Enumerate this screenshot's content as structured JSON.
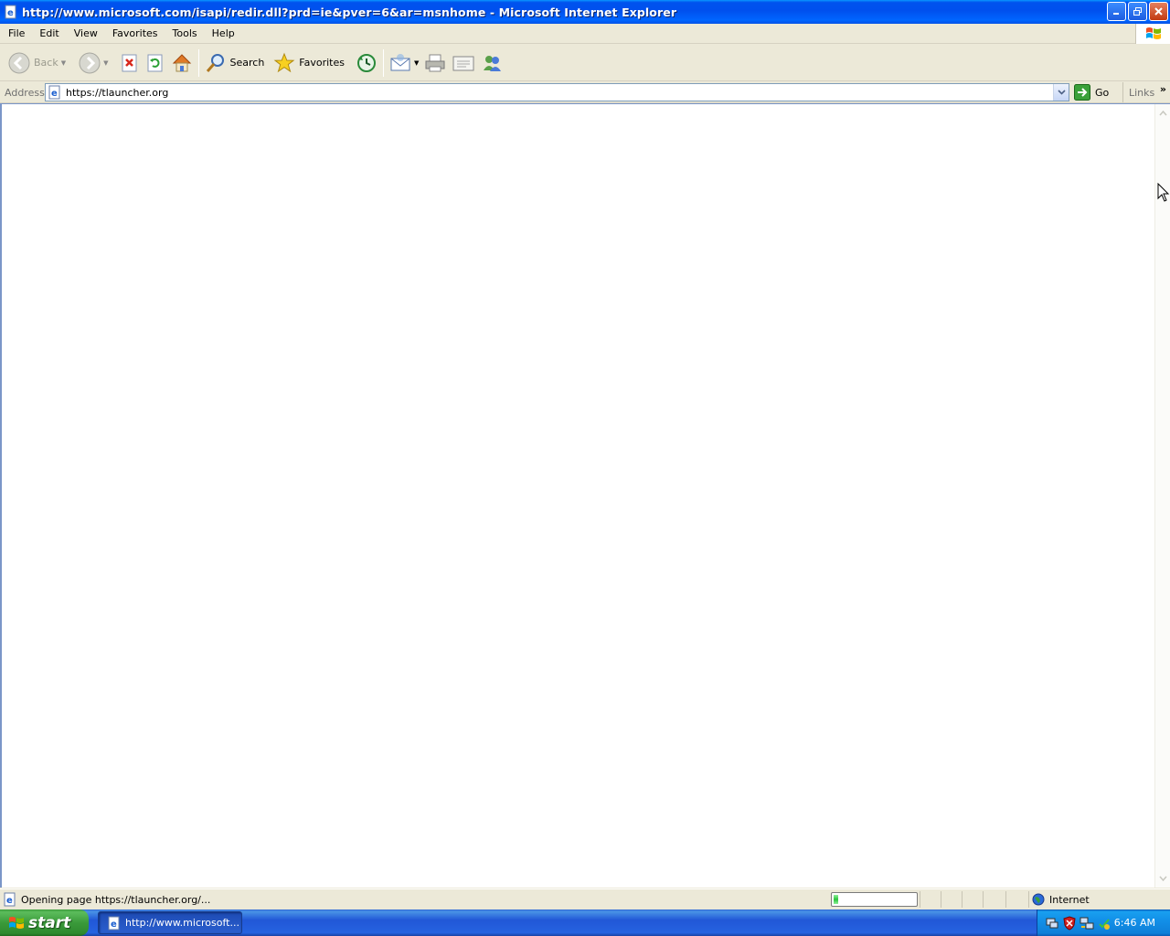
{
  "window": {
    "title": "http://www.microsoft.com/isapi/redir.dll?prd=ie&pver=6&ar=msnhome - Microsoft Internet Explorer"
  },
  "menu": [
    "File",
    "Edit",
    "View",
    "Favorites",
    "Tools",
    "Help"
  ],
  "toolbar": {
    "back_label": "Back",
    "search_label": "Search",
    "favorites_label": "Favorites"
  },
  "address": {
    "label": "Address",
    "url": "https://tlauncher.org",
    "go_label": "Go",
    "links_label": "Links"
  },
  "status": {
    "text": "Opening page https://tlauncher.org/...",
    "progress_fraction": 0.06,
    "zone": "Internet"
  },
  "taskbar": {
    "start_label": "start",
    "task_label": "http://www.microsoft...",
    "clock": "6:46 AM"
  },
  "colors": {
    "titlebar": "#0054E3",
    "taskbar": "#245EDC",
    "start": "#3C9B3C",
    "chrome": "#ECE9D8"
  }
}
